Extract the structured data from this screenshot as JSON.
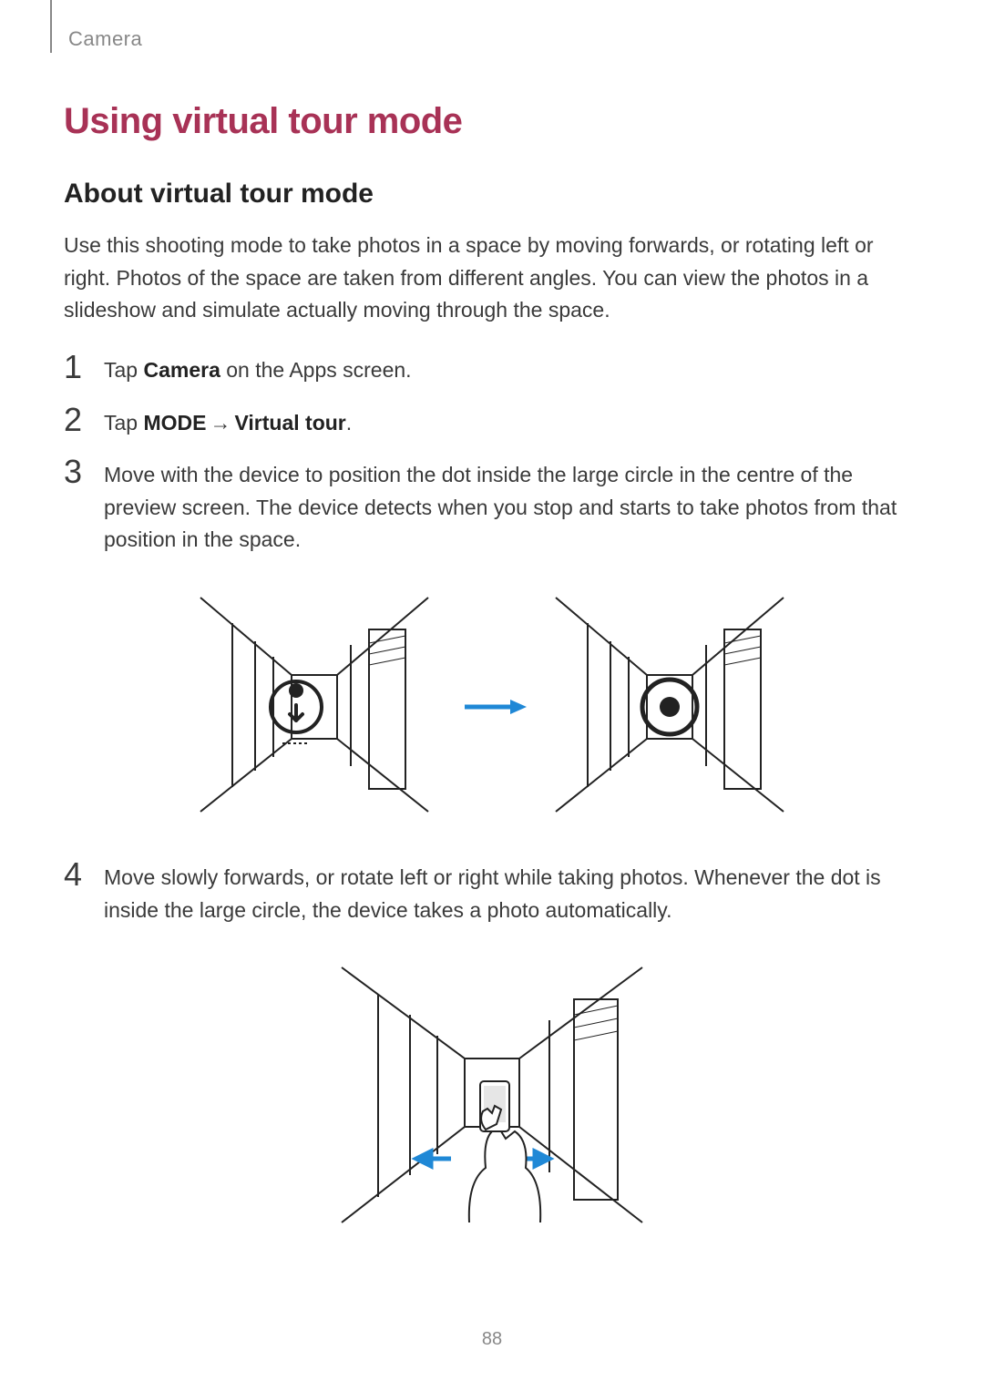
{
  "breadcrumb": "Camera",
  "heading": "Using virtual tour mode",
  "subheading": "About virtual tour mode",
  "intro": "Use this shooting mode to take photos in a space by moving forwards, or rotating left or right. Photos of the space are taken from different angles. You can view the photos in a slideshow and simulate actually moving through the space.",
  "steps": {
    "s1": {
      "num": "1",
      "pre": "Tap ",
      "b1": "Camera",
      "post": " on the Apps screen."
    },
    "s2": {
      "num": "2",
      "pre": "Tap ",
      "b1": "MODE",
      "arrow": " → ",
      "b2": "Virtual tour",
      "post": "."
    },
    "s3": {
      "num": "3",
      "text": "Move with the device to position the dot inside the large circle in the centre of the preview screen. The device detects when you stop and starts to take photos from that position in the space."
    },
    "s4": {
      "num": "4",
      "text": "Move slowly forwards, or rotate left or right while taking photos. Whenever the dot is inside the large circle, the device takes a photo automatically."
    }
  },
  "page_number": "88",
  "colors": {
    "accent": "#a83256",
    "arrow_blue": "#1f88d6"
  }
}
